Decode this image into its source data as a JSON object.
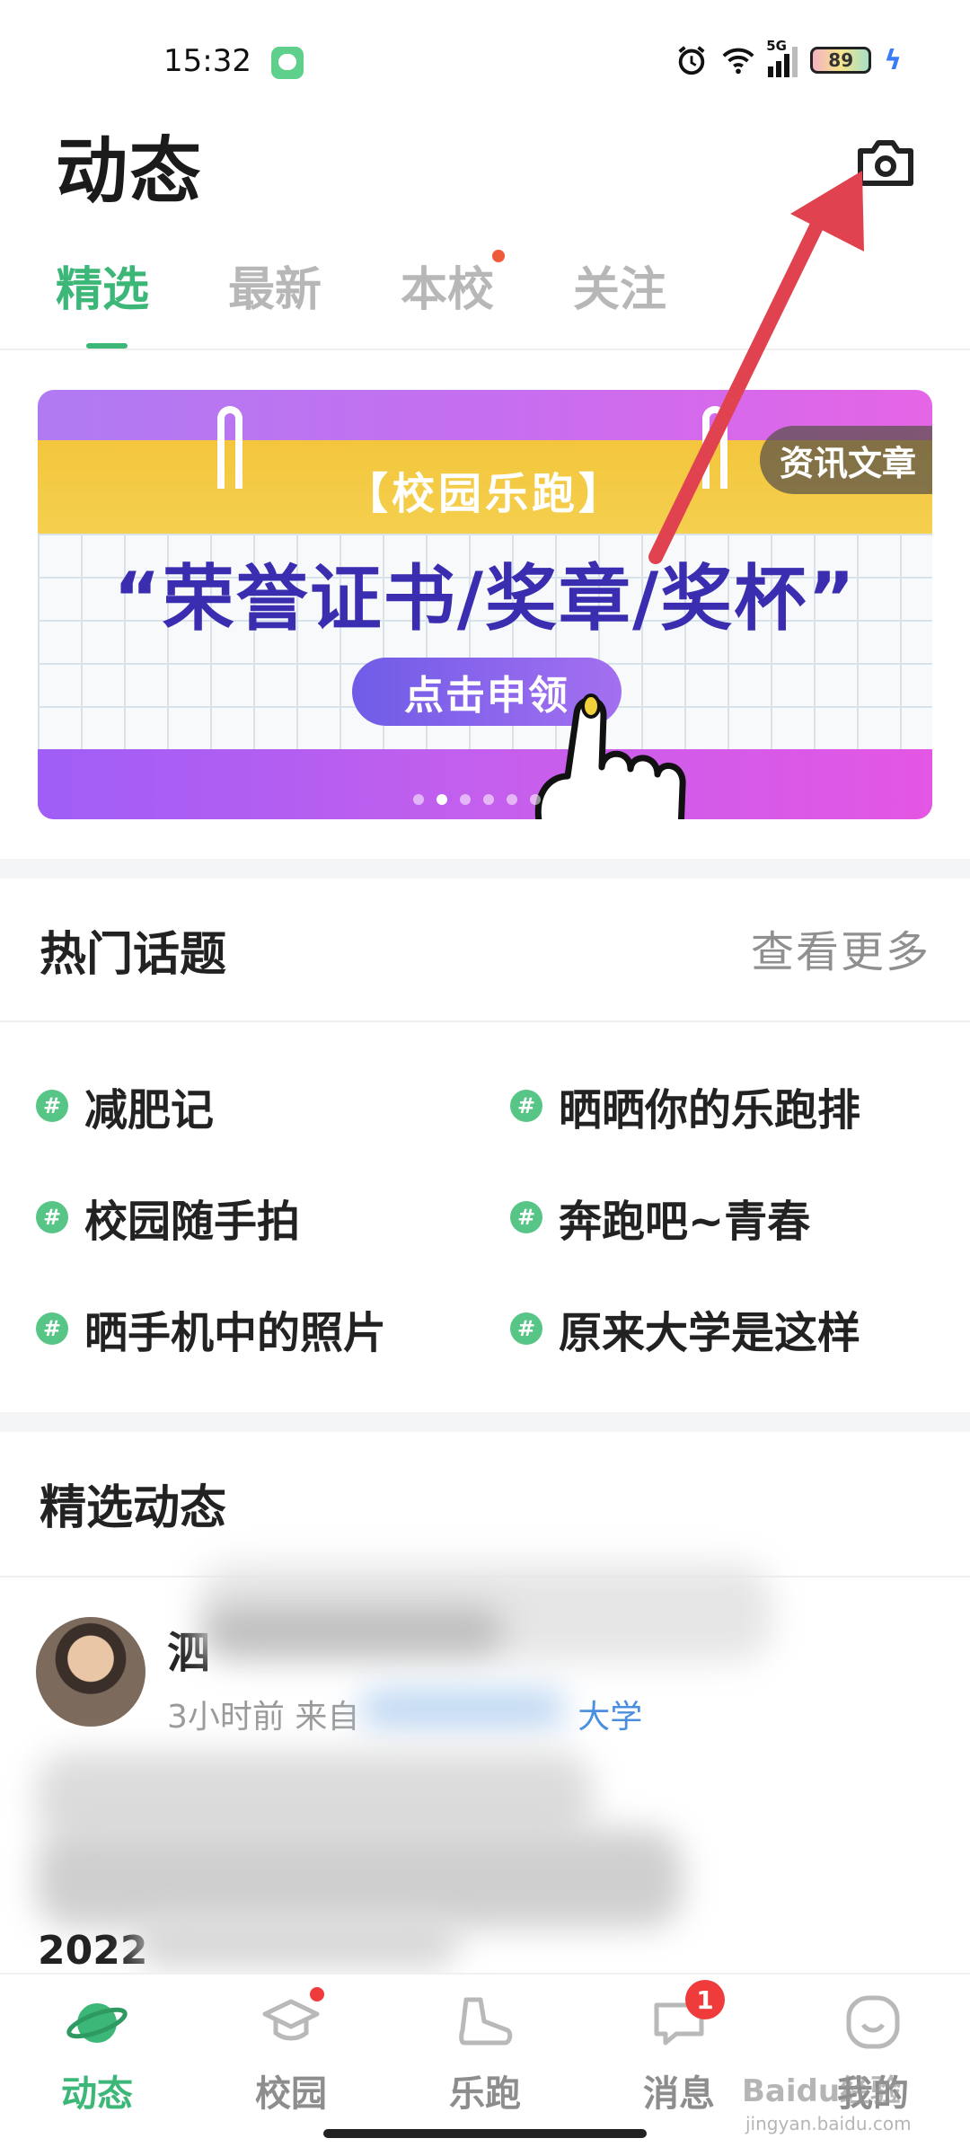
{
  "status_bar": {
    "time": "15:32",
    "network": "5G",
    "battery": "89"
  },
  "header": {
    "title": "动态"
  },
  "tabs": [
    {
      "label": "精选",
      "active": true
    },
    {
      "label": "最新"
    },
    {
      "label": "本校",
      "dot": true
    },
    {
      "label": "关注"
    }
  ],
  "banner": {
    "subtitle": "【校园乐跑】",
    "headline": "“荣誉证书/奖章/奖杯”",
    "cta": "点击申领",
    "tag": "资讯文章"
  },
  "hot_topics": {
    "title": "热门话题",
    "see_more": "查看更多",
    "items": [
      "减肥记",
      "晒晒你的乐跑排",
      "校园随手拍",
      "奔跑吧~青春",
      "晒手机中的照片",
      "原来大学是这样"
    ]
  },
  "featured": {
    "title": "精选动态",
    "post": {
      "author": "泗",
      "meta": "3小时前 来自",
      "school": "大学",
      "date": "2022"
    }
  },
  "bottom_nav": [
    {
      "label": "动态",
      "active": true
    },
    {
      "label": "校园",
      "dot": true
    },
    {
      "label": "乐跑"
    },
    {
      "label": "消息",
      "badge": "1"
    },
    {
      "label": "我的"
    }
  ],
  "watermark": {
    "brand": "Baidu经验",
    "url": "jingyan.baidu.com"
  },
  "colors": {
    "accent": "#3cb777",
    "annotation_arrow": "#e0434f",
    "badge_red": "#ef3b3b"
  }
}
